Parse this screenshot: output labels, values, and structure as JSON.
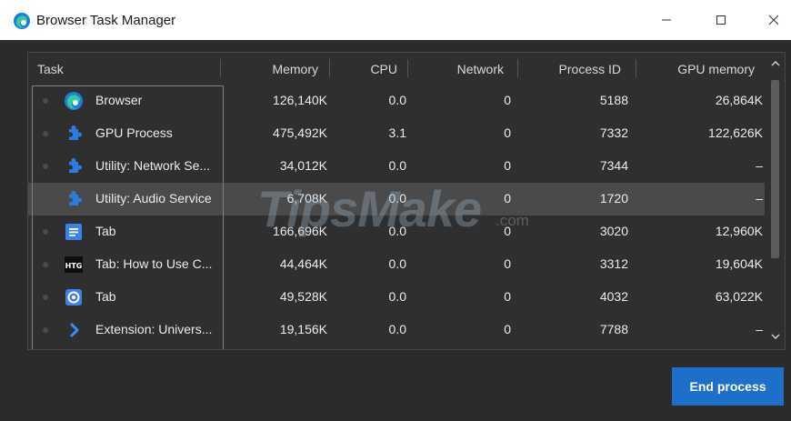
{
  "window": {
    "title": "Browser Task Manager",
    "controls": {
      "minimize": "–",
      "maximize": "□",
      "close": "×"
    }
  },
  "table": {
    "columns": [
      "Task",
      "Memory",
      "CPU",
      "Network",
      "Process ID",
      "GPU memory"
    ],
    "rows": [
      {
        "icon": "edge-logo-icon",
        "task": "Browser",
        "memory": "126,140K",
        "cpu": "0.0",
        "network": "0",
        "pid": "5188",
        "gpu": "26,864K",
        "selected": false
      },
      {
        "icon": "puzzle-piece-icon",
        "task": "GPU Process",
        "memory": "475,492K",
        "cpu": "3.1",
        "network": "0",
        "pid": "7332",
        "gpu": "122,626K",
        "selected": false
      },
      {
        "icon": "puzzle-piece-icon",
        "task": "Utility: Network Se...",
        "memory": "34,012K",
        "cpu": "0.0",
        "network": "0",
        "pid": "7344",
        "gpu": "–",
        "selected": false
      },
      {
        "icon": "puzzle-piece-icon",
        "task": "Utility: Audio Service",
        "memory": "6,708K",
        "cpu": "0.0",
        "network": "0",
        "pid": "1720",
        "gpu": "–",
        "selected": true
      },
      {
        "icon": "document-icon",
        "task": "Tab",
        "memory": "166,696K",
        "cpu": "0.0",
        "network": "0",
        "pid": "3020",
        "gpu": "12,960K",
        "selected": false
      },
      {
        "icon": "htg-logo-icon",
        "task": "Tab: How to Use C...",
        "memory": "44,464K",
        "cpu": "0.0",
        "network": "0",
        "pid": "3312",
        "gpu": "19,604K",
        "selected": false
      },
      {
        "icon": "camera-icon",
        "task": "Tab",
        "memory": "49,528K",
        "cpu": "0.0",
        "network": "0",
        "pid": "4032",
        "gpu": "63,022K",
        "selected": false
      },
      {
        "icon": "chevron-right-icon",
        "task": "Extension: Univers...",
        "memory": "19,156K",
        "cpu": "0.0",
        "network": "0",
        "pid": "7788",
        "gpu": "–",
        "selected": false
      }
    ]
  },
  "htg_icon_text": "HTG",
  "watermark": {
    "main": "TipsMake",
    "sub": ".com"
  },
  "footer": {
    "end_process_label": "End process"
  },
  "colors": {
    "accent": "#1e6fc9",
    "background": "#2b2b2b",
    "selected_row": "#4a4a4a"
  }
}
